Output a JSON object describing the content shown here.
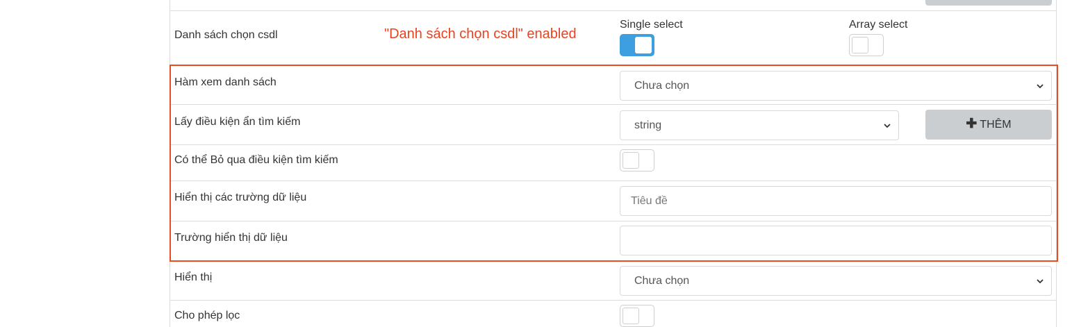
{
  "annotation": "\"Danh sách chọn csdl\" enabled",
  "rows": {
    "danh_sach_chon": {
      "label": "Danh sách chọn csdl",
      "single_select_label": "Single select",
      "single_select_on": true,
      "array_select_label": "Array select",
      "array_select_on": false
    },
    "ham_xem": {
      "label": "Hàm xem danh sách",
      "value": "Chưa chọn"
    },
    "lay_dieu_kien": {
      "label": "Lấy điều kiện ẩn tìm kiếm",
      "value": "string",
      "button_label": "THÊM"
    },
    "co_the_bo_qua": {
      "label": "Có thể Bỏ qua điều kiện tìm kiếm",
      "on": false
    },
    "hien_thi_truong": {
      "label": "Hiển thị các trường dữ liệu",
      "placeholder": "Tiêu đề"
    },
    "truong_hien_thi": {
      "label": "Trường hiển thị dữ liệu",
      "value": ""
    },
    "hien_thi": {
      "label": "Hiển thị",
      "value": "Chưa chọn"
    },
    "cho_phep_loc": {
      "label": "Cho phép lọc",
      "on": false
    }
  },
  "colors": {
    "toggle_on": "#3d9ee0",
    "highlight": "#ea4c22",
    "button_bg": "#cbced1"
  },
  "icons": {
    "add": "plus-icon",
    "dropdown": "chevron-down-icon"
  }
}
